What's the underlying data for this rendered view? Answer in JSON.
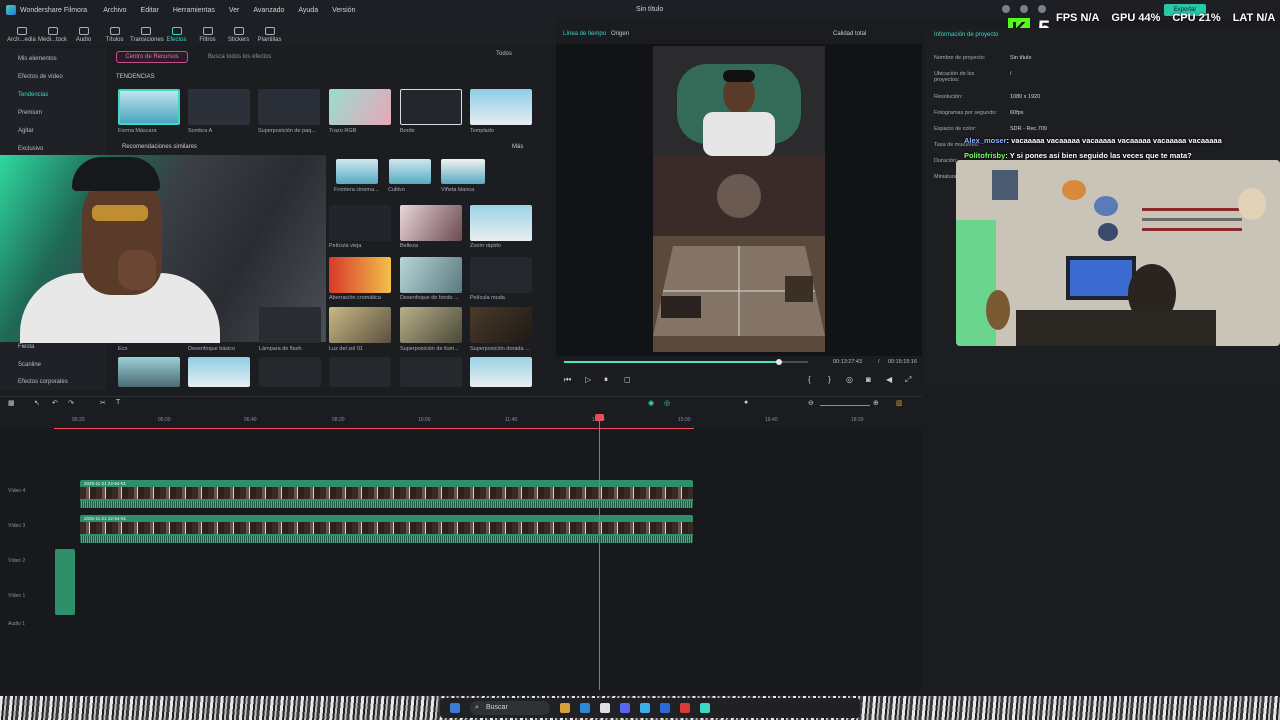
{
  "menubar": {
    "app_name": "Wondershare Filmora",
    "items": [
      "Archivo",
      "Editar",
      "Herramientas",
      "Ver",
      "Avanzado",
      "Ayuda",
      "Versión"
    ],
    "title": "Sin título",
    "export_label": "Exportar"
  },
  "overlay": {
    "kick_letter": "K",
    "kick_count": "5",
    "fps_label": "FPS",
    "fps_value": "N/A",
    "gpu_label": "GPU",
    "gpu_value": "44%",
    "cpu_label": "CPU",
    "cpu_value": "21%",
    "lat_label": "LAT",
    "lat_value": "N/A"
  },
  "media_tabs": [
    "Arch...edia",
    "Medi...tock",
    "Audio",
    "Títulos",
    "Transiciones",
    "Efectos",
    "Filtros",
    "Stickers",
    "Plantillas"
  ],
  "media_tab_active": "Efectos",
  "sidebar": {
    "items": [
      "Mis elementos",
      "Efectos de vídeo",
      "Tendencias",
      "Premium",
      "Agitar",
      "Exclusivo",
      "Fiesta",
      "Scanline",
      "Efectos corporales"
    ],
    "active": "Tendencias"
  },
  "effects": {
    "resource_center": "Centro de Recursos",
    "search_placeholder": "Busca todos los efectos",
    "filter_label": "Todos",
    "section_trending": "TENDENCIAS",
    "trending": [
      "Forma Máscara",
      "Sombra A",
      "Superposición de paq...",
      "Trazo RGB",
      "Borde",
      "Templado"
    ],
    "section_recommend": "Recomendaciones similares",
    "more_label": "Más",
    "recommend_row1": [
      "Frontera cinema...",
      "Cultivo",
      "Viñeta blanca"
    ],
    "grid": [
      [
        "Película vieja",
        "Belleza",
        "Zoom rápido"
      ],
      [
        "Aberración cromática",
        "Desenfoque de fondo ...",
        "Película muda"
      ],
      [
        "Lámpara de flash",
        "Luz del sol 01",
        "Superposición de ilum...",
        "Superposición dorada ..."
      ]
    ],
    "grid_left_labels": [
      "Eco",
      "Desenfoque básico"
    ]
  },
  "preview": {
    "tab_timeline": "Línea de tiempo",
    "tab_origin": "Origen",
    "quality": "Calidad total",
    "current_time": "00:13:27:43",
    "separator": "/",
    "total_time": "00:15:15:16",
    "progress": 0.88
  },
  "project_info": {
    "title": "Información de proyecto",
    "rows": [
      {
        "k": "Nombre de proyecto:",
        "v": "Sin título"
      },
      {
        "k": "Ubicación de los proyectos:",
        "v": "/"
      },
      {
        "k": "Resolución:",
        "v": "1080 x 1920"
      },
      {
        "k": "Fotogramas por segundo:",
        "v": "60fps"
      },
      {
        "k": "Espacio de color:",
        "v": "SDR - Rec.709"
      },
      {
        "k": "Tasa de muestreo:",
        "v": ""
      },
      {
        "k": "Duración:",
        "v": ""
      },
      {
        "k": "Miniatura:",
        "v": ""
      }
    ]
  },
  "chat": [
    {
      "user": "Alex_moser",
      "user_color": "#8fb6ff",
      "text": ": vacaaaaa vacaaaaa vacaaaaa vacaaaaa vacaaaaa vacaaaaa"
    },
    {
      "user": "Politofrisby",
      "user_color": "#7dff6b",
      "text": ": Y si pones así bien seguido las veces que te mata?"
    }
  ],
  "timeline": {
    "ruler": [
      "00:20",
      "05:00",
      "06:40",
      "08:20",
      "10:00",
      "11:40",
      "13:20",
      "15:00",
      "16:40",
      "18:20"
    ],
    "tracks": [
      "Vídeo 4",
      "Vídeo 3",
      "Vídeo 2",
      "Vídeo 1",
      "Audio 1"
    ],
    "clip_label_1": "2025-11-21 22-54-51",
    "clip_label_2": "2025-11-21 22-54-51"
  },
  "taskbar": {
    "search": "Buscar"
  },
  "colors": {
    "accent": "#3fd8c2",
    "playhead": "#f04a5c",
    "clip": "#2f8f6b",
    "kick": "#53fc18"
  }
}
